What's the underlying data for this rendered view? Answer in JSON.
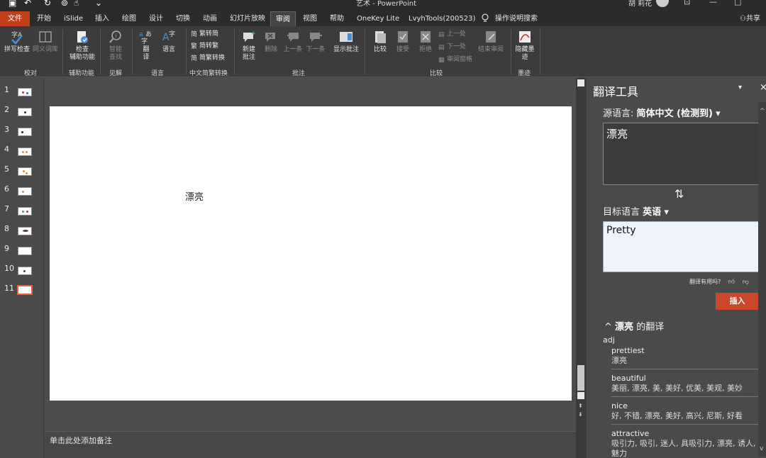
{
  "window": {
    "title": "艺术 - PowerPoint",
    "user": "胡 莉花"
  },
  "tabs": {
    "file": "文件",
    "items": [
      "开始",
      "iSlide",
      "插入",
      "绘图",
      "设计",
      "切换",
      "动画",
      "幻灯片放映",
      "审阅",
      "视图",
      "帮助",
      "OneKey Lite",
      "LvyhTools(200523)"
    ],
    "active": "审阅",
    "tell_me": "操作说明搜索",
    "share": "共享"
  },
  "ribbon": {
    "groups": {
      "proofing": {
        "label": "校对",
        "spelling": "拼写检查",
        "thesaurus": "同义词库"
      },
      "accessibility": {
        "label": "辅助功能",
        "check_1": "检查",
        "check_2": "辅助功能"
      },
      "insights": {
        "label": "见解",
        "smart_1": "智能",
        "smart_2": "查找"
      },
      "language": {
        "label": "语言",
        "translate_1": "翻",
        "translate_2": "译",
        "language": "语言"
      },
      "chinese": {
        "label": "中文简繁转换",
        "to_simplified": "繁转简",
        "to_traditional": "简转繁",
        "convert": "简繁转换"
      },
      "comments": {
        "label": "批注",
        "new_1": "新建",
        "new_2": "批注",
        "delete": "删除",
        "prev": "上一条",
        "next": "下一条",
        "show": "显示批注"
      },
      "compare": {
        "label": "比较",
        "compare": "比较",
        "accept": "接受",
        "reject": "拒绝",
        "prev_change": "上一处",
        "next_change": "下一处",
        "reviewing_pane": "审阅窗格",
        "end_review": "结束审阅"
      },
      "ink": {
        "label": "墨迹",
        "hide_1": "隐藏墨",
        "hide_2": "迹"
      }
    }
  },
  "slides": {
    "numbers": [
      "1",
      "2",
      "3",
      "4",
      "5",
      "6",
      "7",
      "8",
      "9",
      "10",
      "11"
    ],
    "active": 11
  },
  "slide": {
    "text": "漂亮"
  },
  "notes": {
    "placeholder": "单击此处添加备注"
  },
  "translator": {
    "title": "翻译工具",
    "source_label": "源语言:",
    "source_lang": "简体中文 (检测到)",
    "source_text": "漂亮",
    "target_label": "目标语言",
    "target_lang": "英语",
    "target_text": "Pretty",
    "feedback": "翻译有用吗?",
    "insert": "插入",
    "results_word": "漂亮",
    "results_suffix": "的翻译",
    "pos": "adj",
    "entries": [
      {
        "en": "prettiest",
        "zh": "漂亮"
      },
      {
        "en": "beautiful",
        "zh": "美丽, 漂亮, 美, 美好, 优美, 美观, 美妙"
      },
      {
        "en": "nice",
        "zh": "好, 不错, 漂亮, 美好, 高兴, 尼斯, 好看"
      },
      {
        "en": "attractive",
        "zh": "吸引力, 吸引, 迷人, 具吸引力, 漂亮, 诱人, 魅力"
      }
    ]
  },
  "colors": {
    "accent": "#c43e1c",
    "insert": "#c9472a",
    "active_thumb": "#e0653a"
  }
}
